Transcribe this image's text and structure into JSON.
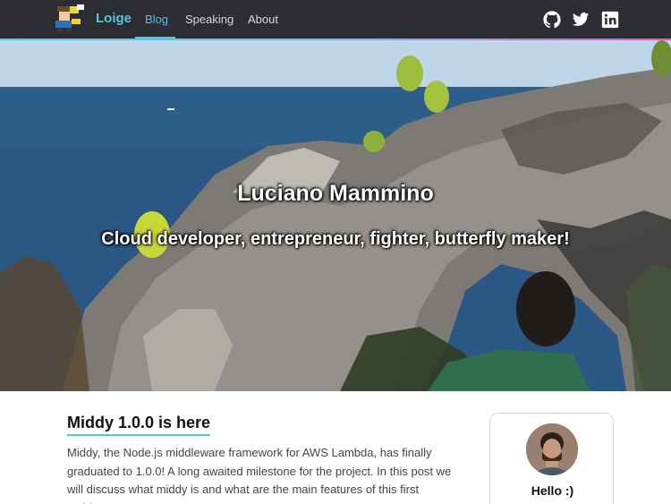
{
  "nav": {
    "brand": "Loige",
    "links": [
      {
        "label": "Blog",
        "active": true
      },
      {
        "label": "Speaking",
        "active": false
      },
      {
        "label": "About",
        "active": false
      }
    ],
    "social": [
      "github-icon",
      "twitter-icon",
      "linkedin-icon"
    ]
  },
  "hero": {
    "name": "Luciano Mammino",
    "tagline": "Cloud developer, entrepreneur, fighter, butterfly maker!"
  },
  "post": {
    "title": "Middy 1.0.0 is here",
    "excerpt": "Middy, the Node.js middleware framework for AWS Lambda, has finally graduated to 1.0.0! A long awaited milestone for the project. In this post we will discuss what middy is and what are the main features of this first stable"
  },
  "sidebar": {
    "greeting": "Hello :)"
  },
  "colors": {
    "navbar_bg": "#2b2d33",
    "accent": "#59c3e0"
  }
}
